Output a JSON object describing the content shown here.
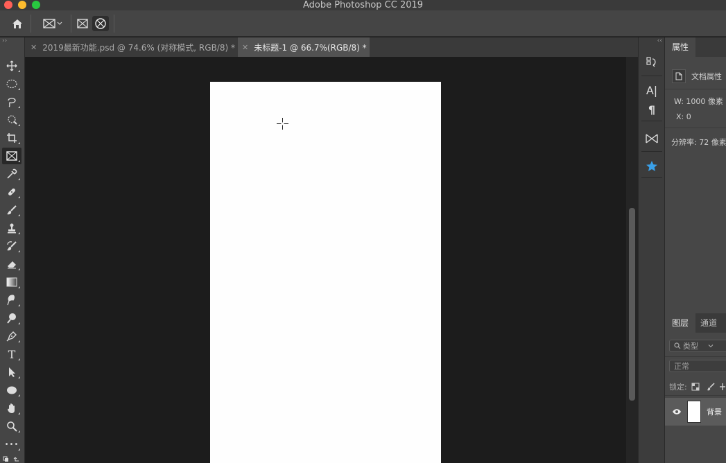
{
  "window": {
    "title": "Adobe Photoshop CC 2019"
  },
  "tabs": [
    {
      "label": "2019最新功能.psd @ 74.6% (对称模式, RGB/8) *",
      "active": false
    },
    {
      "label": "未标题-1 @ 66.7%(RGB/8) *",
      "active": true
    }
  ],
  "toolbar": {
    "tools": [
      "move-icon",
      "marquee-icon",
      "lasso-icon",
      "quick-select-icon",
      "crop-icon",
      "frame-icon",
      "eyedropper-icon",
      "healing-icon",
      "brush-icon",
      "stamp-icon",
      "history-brush-icon",
      "eraser-icon",
      "gradient-icon",
      "blur-icon",
      "dodge-icon",
      "pen-icon",
      "type-icon",
      "path-select-icon",
      "shape-icon",
      "hand-icon",
      "zoom-icon",
      "more-icon"
    ],
    "active_tool": "frame-icon",
    "type_glyph": "T",
    "more_glyph": "•••"
  },
  "options_bar": {
    "items": [
      "home-icon",
      "frame-tool-preset-icon",
      "rect-frame-icon",
      "ellipse-frame-icon"
    ]
  },
  "icon_strip": {
    "items": [
      "history-icon",
      "character-icon",
      "paragraph-icon",
      "glyph-icon",
      "libraries-icon"
    ],
    "collapse": "‹‹",
    "character_glyph": "A|",
    "paragraph_glyph": "¶"
  },
  "properties_panel": {
    "tab": "属性",
    "doc_label": "文档属性",
    "width": "W: 1000 像素",
    "x": "X: 0",
    "resolution": "分辨率: 72 像素"
  },
  "layers_panel": {
    "tabs": [
      "图层",
      "通道"
    ],
    "search_placeholder": "类型",
    "blend_mode": "正常",
    "lock_label": "锁定:",
    "layer_name": "背景"
  },
  "colors": {
    "canvas_bg": "#1c1c1c",
    "document": "#fefefe",
    "panel": "#474747",
    "accent_star": "#3aa0e8"
  }
}
